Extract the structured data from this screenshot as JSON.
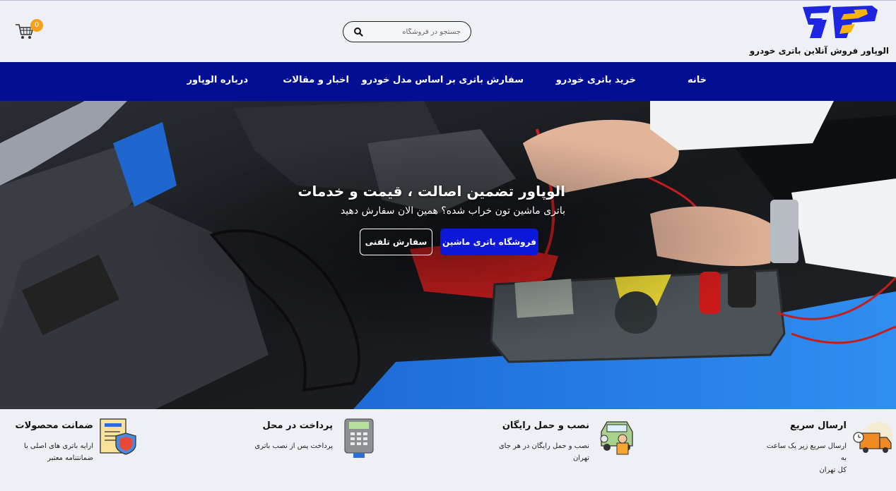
{
  "header": {
    "tagline": "الوپاور فروش آنلاین باتری خودرو",
    "search_placeholder": "جستجو در فروشگاه",
    "cart_count": "0"
  },
  "nav": {
    "items": [
      {
        "label": "خانه"
      },
      {
        "label": "خرید باتری خودرو"
      },
      {
        "label": "سفارش باتری بر اساس مدل خودرو"
      },
      {
        "label": "اخبار و مقالات"
      },
      {
        "label": "درباره الوپاور"
      }
    ]
  },
  "hero": {
    "title": "الوپاور تضمین اصالت ، قیمت و خدمات",
    "subtitle": "باتری ماشین تون خراب شده؟ همین الان سفارش دهید",
    "primary_button": "فروشگاه باتری ماشین",
    "secondary_button": "سفارش تلفنی"
  },
  "features": [
    {
      "title": "ارسال سریع",
      "desc_line1": "ارسال سریع زیر یک ساعت به",
      "desc_line2": "کل تهران",
      "icon": "delivery-truck-icon"
    },
    {
      "title": "نصب و حمل رایگان",
      "desc_line1": "نصب و حمل رایگان در هر جای",
      "desc_line2": "تهران",
      "icon": "car-mechanic-icon"
    },
    {
      "title": "پرداخت در محل",
      "desc_line1": "پرداخت پس از نصب باتری",
      "desc_line2": "",
      "icon": "pos-terminal-icon"
    },
    {
      "title": "ضمانت محصولات",
      "desc_line1": "ارایه باتری های اصلی با",
      "desc_line2": "ضمانتنامه معتبر",
      "icon": "warranty-shield-icon"
    }
  ],
  "colors": {
    "nav_bg": "#020f92",
    "primary_button": "#0d17d8",
    "badge": "#f5a11c",
    "logo_blue": "#1d25e0",
    "logo_yellow": "#f7b500"
  }
}
